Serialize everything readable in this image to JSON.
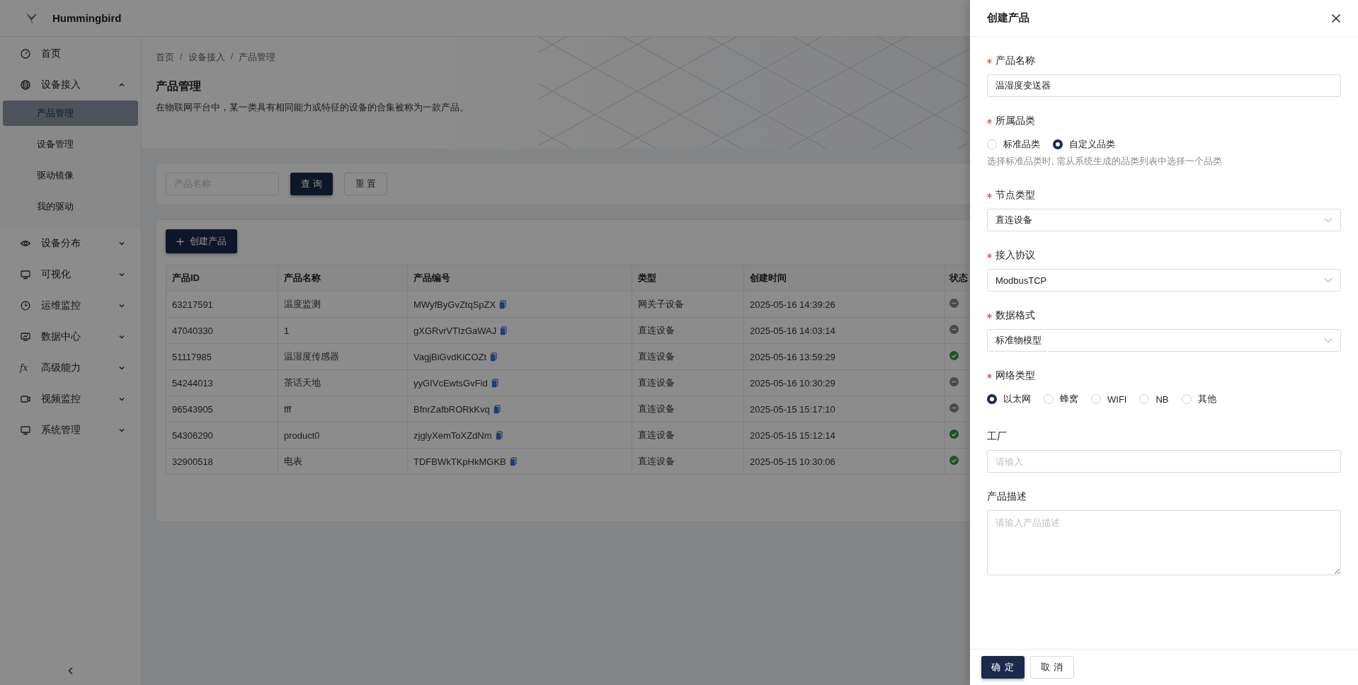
{
  "app": {
    "name": "Hummingbird"
  },
  "sidebar": {
    "items": [
      {
        "label": "首页",
        "kind": "link",
        "selected": false
      },
      {
        "label": "设备接入",
        "kind": "group",
        "selected": false,
        "expanded": true,
        "children": [
          {
            "label": "产品管理",
            "selected": true
          },
          {
            "label": "设备管理",
            "selected": false
          },
          {
            "label": "驱动镜像",
            "selected": false
          },
          {
            "label": "我的驱动",
            "selected": false
          }
        ]
      },
      {
        "label": "设备分布",
        "kind": "group",
        "selected": false,
        "expanded": false
      },
      {
        "label": "可视化",
        "kind": "group",
        "selected": false,
        "expanded": false
      },
      {
        "label": "运维监控",
        "kind": "group",
        "selected": false,
        "expanded": false
      },
      {
        "label": "数据中心",
        "kind": "group",
        "selected": false,
        "expanded": false
      },
      {
        "label": "高级能力",
        "kind": "group",
        "selected": false,
        "expanded": false,
        "icon_text": "fx"
      },
      {
        "label": "视频监控",
        "kind": "group",
        "selected": false,
        "expanded": false
      },
      {
        "label": "系统管理",
        "kind": "group",
        "selected": false,
        "expanded": false
      }
    ]
  },
  "breadcrumb": {
    "separator": "/",
    "items": [
      "首页",
      "设备接入",
      "产品管理"
    ]
  },
  "page": {
    "title": "产品管理",
    "description": "在物联网平台中，某一类具有相同能力或特征的设备的合集被称为一款产品。"
  },
  "search": {
    "placeholder": "产品名称",
    "buttons": [
      {
        "label": "查 询",
        "kind": "primary"
      },
      {
        "label": "重 置",
        "kind": "default"
      }
    ]
  },
  "create_button": "创建产品",
  "table": {
    "columns": [
      "产品ID",
      "产品名称",
      "产品编号",
      "类型",
      "创建时间",
      "状态"
    ],
    "rows": [
      {
        "id": "63217591",
        "name": "温度监测",
        "code": "MWyfByGvZtqSpZX",
        "type": "网关子设备",
        "created": "2025-05-16 14:39:26",
        "active": false
      },
      {
        "id": "47040330",
        "name": "1",
        "code": "gXGRvrVTIzGaWAJ",
        "type": "直连设备",
        "created": "2025-05-16 14:03:14",
        "active": false
      },
      {
        "id": "51117985",
        "name": "温湿度传感器",
        "code": "VagjBiGvdKiCOZt",
        "type": "直连设备",
        "created": "2025-05-16 13:59:29",
        "active": true
      },
      {
        "id": "54244013",
        "name": "茶话天地",
        "code": "yyGIVcEwtsGvFid",
        "type": "直连设备",
        "created": "2025-05-16 10:30:29",
        "active": false
      },
      {
        "id": "96543905",
        "name": "fff",
        "code": "BfnrZafbRORkKvq",
        "type": "直连设备",
        "created": "2025-05-15 15:17:10",
        "active": false
      },
      {
        "id": "54306290",
        "name": "product0",
        "code": "zjglyXemToXZdNm",
        "type": "直连设备",
        "created": "2025-05-15 15:12:14",
        "active": true
      },
      {
        "id": "32900518",
        "name": "电表",
        "code": "TDFBWkTKpHkMGKB",
        "type": "直连设备",
        "created": "2025-05-15 10:30:06",
        "active": true
      }
    ]
  },
  "drawer": {
    "title": "创建产品",
    "fields": [
      {
        "label": "产品名称",
        "required": true,
        "kind": "input",
        "value": "温湿度变送器"
      },
      {
        "label": "所属品类",
        "required": true,
        "kind": "radio",
        "options": [
          {
            "label": "标准品类",
            "selected": false
          },
          {
            "label": "自定义品类",
            "selected": true
          }
        ],
        "help": "选择标准品类时, 需从系统生成的品类列表中选择一个品类"
      },
      {
        "label": "节点类型",
        "required": true,
        "kind": "select",
        "value": "直连设备"
      },
      {
        "label": "接入协议",
        "required": true,
        "kind": "select",
        "value": "ModbusTCP"
      },
      {
        "label": "数据格式",
        "required": true,
        "kind": "select",
        "value": "标准物模型"
      },
      {
        "label": "网络类型",
        "required": true,
        "kind": "radio",
        "options": [
          {
            "label": "以太网",
            "selected": true
          },
          {
            "label": "蜂窝",
            "selected": false
          },
          {
            "label": "WIFI",
            "selected": false
          },
          {
            "label": "NB",
            "selected": false
          },
          {
            "label": "其他",
            "selected": false
          }
        ]
      },
      {
        "label": "工厂",
        "required": false,
        "kind": "input",
        "placeholder": "请输入"
      },
      {
        "label": "产品描述",
        "required": false,
        "kind": "textarea",
        "placeholder": "请输入产品描述"
      }
    ],
    "buttons": [
      {
        "label": "确 定",
        "kind": "primary"
      },
      {
        "label": "取 消",
        "kind": "default"
      }
    ]
  }
}
